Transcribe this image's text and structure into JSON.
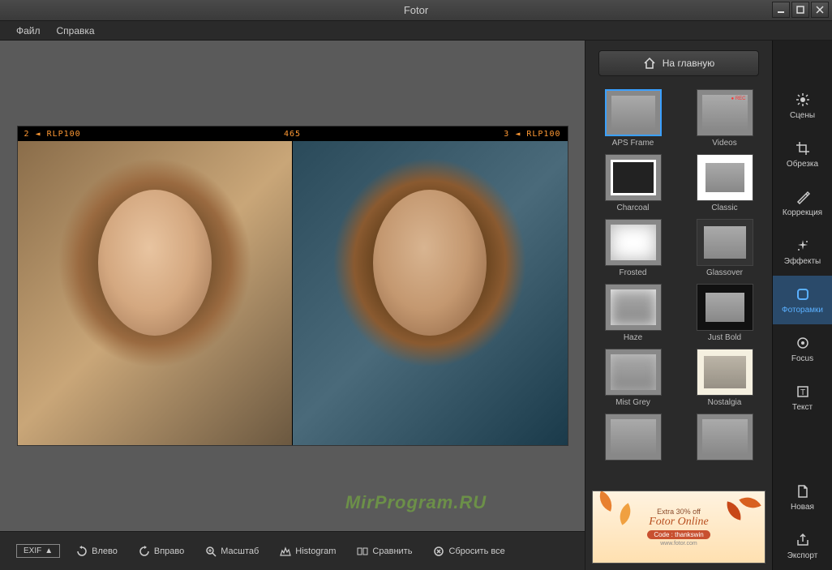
{
  "window": {
    "title": "Fotor"
  },
  "menubar": {
    "file": "Файл",
    "help": "Справка"
  },
  "home_button": "На главную",
  "film": {
    "left": "2 ◄ RLP100",
    "center": "465",
    "right": "3 ◄ RLP100"
  },
  "frames": [
    {
      "id": "aps",
      "label": "APS Frame",
      "variant": "fv-aps",
      "selected": true
    },
    {
      "id": "videos",
      "label": "Videos",
      "variant": "fv-videos"
    },
    {
      "id": "charcoal",
      "label": "Charcoal",
      "variant": "fv-charcoal"
    },
    {
      "id": "classic",
      "label": "Classic",
      "variant": "fv-classic"
    },
    {
      "id": "frosted",
      "label": "Frosted",
      "variant": "fv-frosted"
    },
    {
      "id": "glassover",
      "label": "Glassover",
      "variant": "fv-glassover"
    },
    {
      "id": "haze",
      "label": "Haze",
      "variant": "fv-haze"
    },
    {
      "id": "justbold",
      "label": "Just Bold",
      "variant": "fv-justbold"
    },
    {
      "id": "mistgrey",
      "label": "Mist Grey",
      "variant": "fv-mistgrey"
    },
    {
      "id": "nostalgia",
      "label": "Nostalgia",
      "variant": "fv-nostalgia"
    },
    {
      "id": "extra1",
      "label": "",
      "variant": ""
    },
    {
      "id": "extra2",
      "label": "",
      "variant": ""
    }
  ],
  "side_tools": [
    {
      "id": "scenes",
      "label": "Сцены"
    },
    {
      "id": "crop",
      "label": "Обрезка"
    },
    {
      "id": "correction",
      "label": "Коррекция"
    },
    {
      "id": "effects",
      "label": "Эффекты"
    },
    {
      "id": "frames",
      "label": "Фоторамки",
      "active": true
    },
    {
      "id": "focus",
      "label": "Focus"
    },
    {
      "id": "text",
      "label": "Текст"
    }
  ],
  "side_tools_bottom": [
    {
      "id": "new",
      "label": "Новая"
    },
    {
      "id": "export",
      "label": "Экспорт"
    }
  ],
  "bottom_toolbar": {
    "exif": "EXIF",
    "left": "Влево",
    "right": "Вправо",
    "zoom": "Масштаб",
    "histogram": "Histogram",
    "compare": "Сравнить",
    "reset": "Сбросить все"
  },
  "promo": {
    "discount": "Extra 30% off",
    "title": "Fotor Online",
    "code": "Code : thankswin",
    "url": "www.fotor.com"
  },
  "watermark": "MirProgram.RU"
}
